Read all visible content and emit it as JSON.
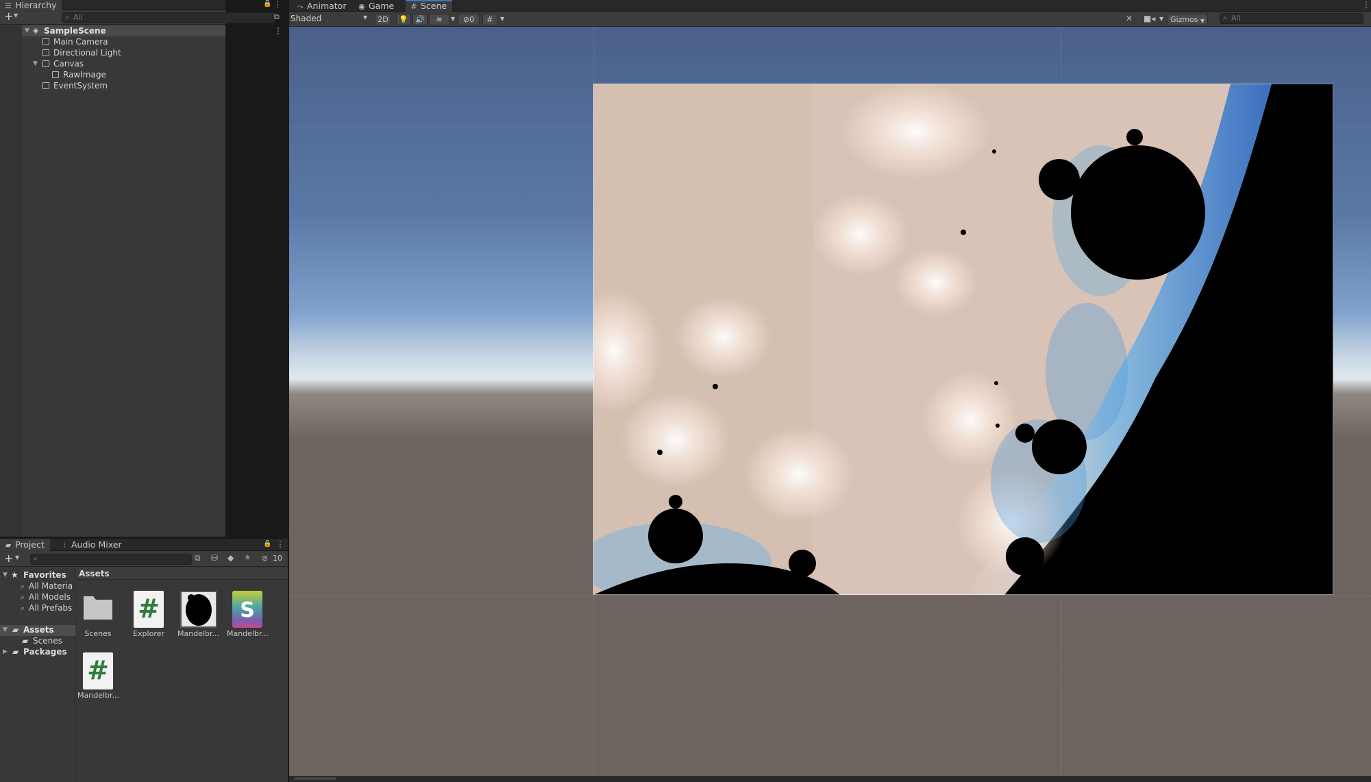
{
  "hierarchy": {
    "tab_label": "Hierarchy",
    "search_placeholder": "All",
    "scene_name": "SampleScene",
    "items": [
      {
        "label": "Main Camera"
      },
      {
        "label": "Directional Light"
      },
      {
        "label": "Canvas"
      },
      {
        "label": "RawImage"
      },
      {
        "label": "EventSystem"
      }
    ]
  },
  "scene_tabs": {
    "tabs": [
      {
        "label": "Animator",
        "icon": "animator-icon"
      },
      {
        "label": "Game",
        "icon": "gamepad-icon"
      },
      {
        "label": "Scene",
        "icon": "grid-icon",
        "active": true
      }
    ]
  },
  "scene_toolbar": {
    "shading_mode": "Shaded",
    "mode_2d": "2D",
    "hidden_count": "0",
    "gizmos_label": "Gizmos",
    "search_placeholder": "All"
  },
  "project": {
    "tabs": [
      {
        "label": "Project",
        "icon": "folder-icon"
      },
      {
        "label": "Audio Mixer",
        "icon": "mixer-icon"
      }
    ],
    "hidden_count": "10",
    "favorites_label": "Favorites",
    "favorites": [
      "All Materia",
      "All Models",
      "All Prefabs"
    ],
    "tree_assets": "Assets",
    "tree_scenes": "Scenes",
    "tree_packages": "Packages",
    "breadcrumb": "Assets",
    "assets": [
      {
        "label": "Scenes",
        "kind": "folder"
      },
      {
        "label": "Explorer",
        "kind": "csharp-script"
      },
      {
        "label": "Mandelbr...",
        "kind": "texture"
      },
      {
        "label": "Mandelbr...",
        "kind": "shader"
      },
      {
        "label": "Mandelbr...",
        "kind": "csharp-script"
      }
    ]
  },
  "colors": {
    "accent_blue": "#3a79bb",
    "editor_bg": "#383838",
    "sky_top": "#4e6990",
    "ground": "#6e6560",
    "fractal_bg": "#d9c3b6"
  }
}
